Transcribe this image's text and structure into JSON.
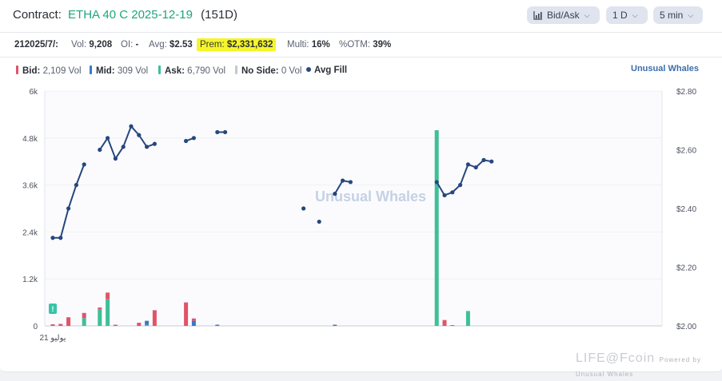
{
  "header": {
    "label": "Contract:",
    "symbol": "ETHA 40 C 2025-12-19",
    "dte": "(151D)",
    "dropdowns": [
      {
        "label": "Bid/Ask"
      },
      {
        "label": "1 D"
      },
      {
        "label": "5 min"
      }
    ]
  },
  "stats": {
    "date": "212025/7/:",
    "vol_label": "Vol:",
    "vol": "9,208",
    "oi_label": "OI:",
    "oi": "-",
    "avg_label": "Avg:",
    "avg": "$2.53",
    "prem_label": "Prem:",
    "prem": "$2,331,632",
    "multi_label": "Multi:",
    "multi": "16%",
    "otm_label": "%OTM:",
    "otm": "39%"
  },
  "legend": {
    "bid_label": "Bid:",
    "bid_val": "2,109 Vol",
    "mid_label": "Mid:",
    "mid_val": "309 Vol",
    "ask_label": "Ask:",
    "ask_val": "6,790 Vol",
    "noside_label": "No Side:",
    "noside_val": "0 Vol",
    "fill_label": "Avg Fill",
    "brand_a": "Unusual",
    "brand_b": "Whales"
  },
  "watermark": {
    "center": "Unusual Whales",
    "corner": "LIFE@Fcoin",
    "corner_small": "Powered by Unusual Whales"
  },
  "colors": {
    "bid": "#e05468",
    "mid": "#3a78c8",
    "ask": "#3fbf96",
    "fill": "#26477e",
    "noside": "#c4c8cf"
  },
  "chart_data": {
    "type": "bar+line",
    "x_label_first": "21 يوليو",
    "left_axis": {
      "ylim": [
        0,
        6000
      ],
      "ticks": [
        "0",
        "1.2k",
        "2.4k",
        "3.6k",
        "4.8k",
        "6k"
      ],
      "tick_values": [
        0,
        1200,
        2400,
        3600,
        4800,
        6000
      ]
    },
    "right_axis": {
      "ylim": [
        2.0,
        2.8
      ],
      "ticks": [
        "$2.00",
        "$2.20",
        "$2.40",
        "$2.60",
        "$2.80"
      ],
      "tick_values": [
        2.0,
        2.2,
        2.4,
        2.6,
        2.8
      ]
    },
    "x_range": [
      0,
      78
    ],
    "alert_marker_x": 0,
    "bars": [
      {
        "x": 0,
        "bid": 40,
        "mid": 0,
        "ask": 0
      },
      {
        "x": 1,
        "bid": 50,
        "mid": 0,
        "ask": 0
      },
      {
        "x": 2,
        "bid": 220,
        "mid": 0,
        "ask": 0
      },
      {
        "x": 4,
        "bid": 130,
        "mid": 0,
        "ask": 200
      },
      {
        "x": 6,
        "bid": 40,
        "mid": 0,
        "ask": 430
      },
      {
        "x": 7,
        "bid": 170,
        "mid": 0,
        "ask": 680
      },
      {
        "x": 8,
        "bid": 30,
        "mid": 0,
        "ask": 0
      },
      {
        "x": 11,
        "bid": 80,
        "mid": 0,
        "ask": 0
      },
      {
        "x": 12,
        "bid": 0,
        "mid": 100,
        "ask": 30
      },
      {
        "x": 13,
        "bid": 400,
        "mid": 0,
        "ask": 0
      },
      {
        "x": 17,
        "bid": 600,
        "mid": 0,
        "ask": 0
      },
      {
        "x": 18,
        "bid": 60,
        "mid": 130,
        "ask": 0
      },
      {
        "x": 21,
        "bid": 0,
        "mid": 30,
        "ask": 0
      },
      {
        "x": 36,
        "bid": 0,
        "mid": 30,
        "ask": 0
      },
      {
        "x": 49,
        "bid": 0,
        "mid": 0,
        "ask": 5000
      },
      {
        "x": 50,
        "bid": 150,
        "mid": 0,
        "ask": 0
      },
      {
        "x": 51,
        "bid": 20,
        "mid": 0,
        "ask": 0
      },
      {
        "x": 53,
        "bid": 0,
        "mid": 0,
        "ask": 380
      }
    ],
    "avg_fill_segments": [
      [
        [
          0,
          2.3
        ],
        [
          1,
          2.3
        ],
        [
          2,
          2.4
        ],
        [
          3,
          2.48
        ],
        [
          4,
          2.55
        ]
      ],
      [
        [
          6,
          2.6
        ],
        [
          7,
          2.64
        ],
        [
          8,
          2.57
        ],
        [
          9,
          2.61
        ],
        [
          10,
          2.68
        ],
        [
          11,
          2.65
        ],
        [
          12,
          2.61
        ],
        [
          13,
          2.62
        ]
      ],
      [
        [
          17,
          2.63
        ],
        [
          18,
          2.64
        ]
      ],
      [
        [
          21,
          2.66
        ],
        [
          22,
          2.66
        ]
      ],
      [
        [
          32,
          2.4
        ]
      ],
      [
        [
          34,
          2.355
        ]
      ],
      [
        [
          36,
          2.45
        ],
        [
          37,
          2.495
        ],
        [
          38,
          2.49
        ]
      ],
      [
        [
          49,
          2.49
        ],
        [
          50,
          2.445
        ],
        [
          51,
          2.455
        ],
        [
          52,
          2.48
        ],
        [
          53,
          2.55
        ],
        [
          54,
          2.54
        ],
        [
          55,
          2.565
        ],
        [
          56,
          2.56
        ]
      ]
    ]
  }
}
